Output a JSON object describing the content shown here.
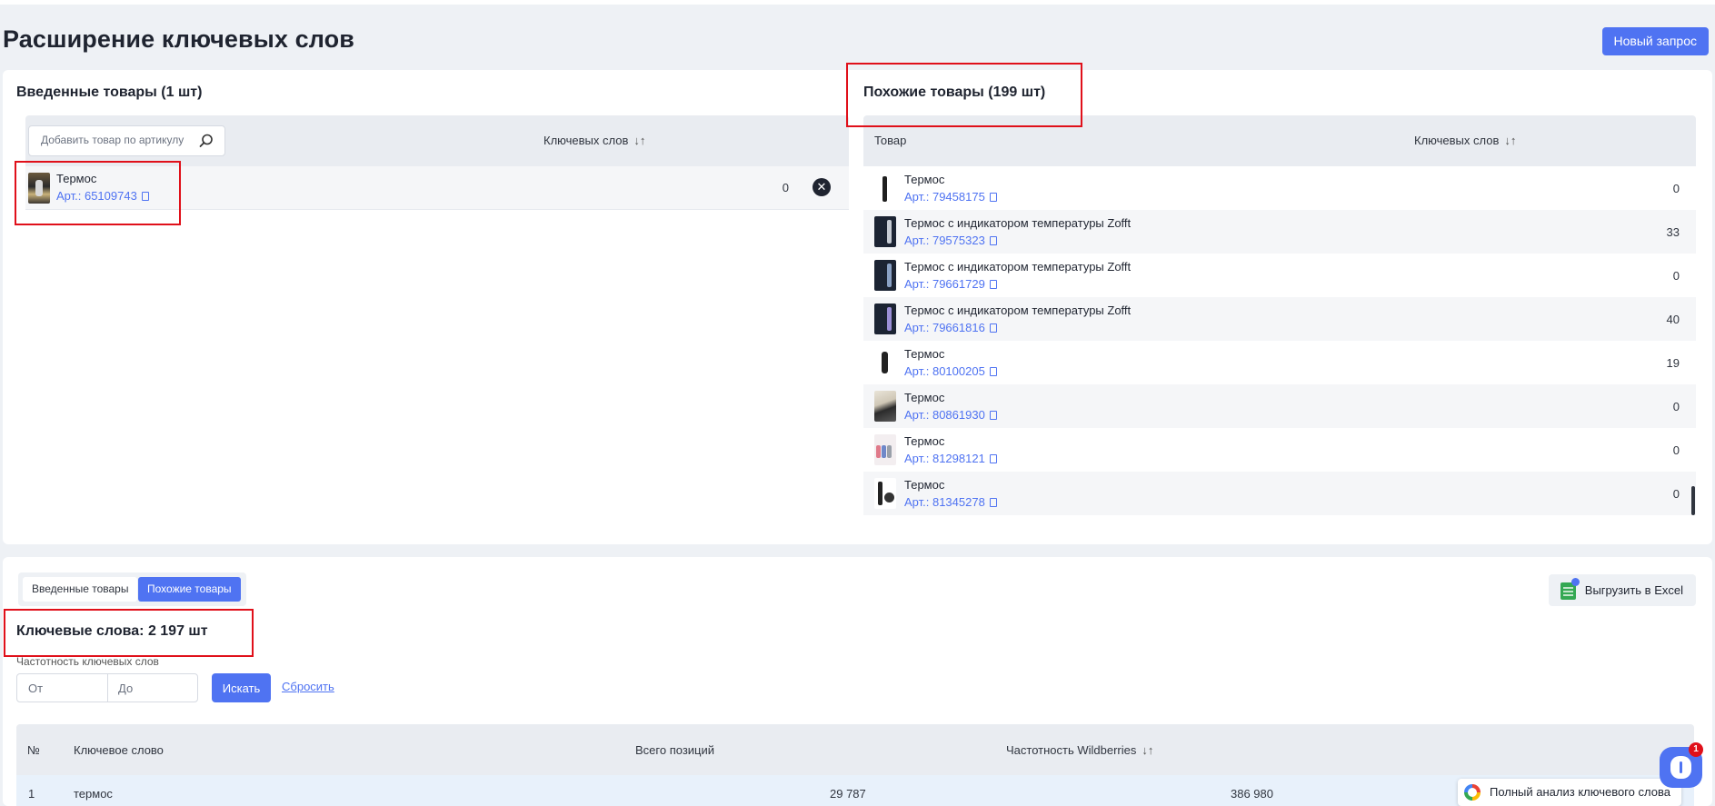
{
  "header": {
    "title": "Расширение ключевых слов",
    "new_request_label": "Новый запрос"
  },
  "entered": {
    "title": "Введенные товары (1 шт)",
    "search_placeholder": "Добавить товар по артикулу",
    "col_keywords": "Ключевых слов",
    "sort_glyph": "↓↑",
    "items": [
      {
        "name": "Термос",
        "article": "Арт.: 65109743",
        "keywords": "0"
      }
    ]
  },
  "similar": {
    "title": "Похожие товары (199 шт)",
    "col_product": "Товар",
    "col_keywords": "Ключевых слов",
    "sort_glyph": "↓↑",
    "items": [
      {
        "name": "Термос",
        "article": "Арт.: 79458175",
        "keywords": "0"
      },
      {
        "name": "Термос с индикатором температуры Zofft",
        "article": "Арт.: 79575323",
        "keywords": "33"
      },
      {
        "name": "Термос с индикатором температуры Zofft",
        "article": "Арт.: 79661729",
        "keywords": "0"
      },
      {
        "name": "Термос с индикатором температуры Zofft",
        "article": "Арт.: 79661816",
        "keywords": "40"
      },
      {
        "name": "Термос",
        "article": "Арт.: 80100205",
        "keywords": "19"
      },
      {
        "name": "Термос",
        "article": "Арт.: 80861930",
        "keywords": "0"
      },
      {
        "name": "Термос",
        "article": "Арт.: 81298121",
        "keywords": "0"
      },
      {
        "name": "Термос",
        "article": "Арт.: 81345278",
        "keywords": "0"
      }
    ]
  },
  "keywords": {
    "tab_entered": "Введенные товары",
    "tab_similar": "Похожие товары",
    "export_label": "Выгрузить в Excel",
    "title": "Ключевые слова: 2 197 шт",
    "freq_label": "Частотность ключевых слов",
    "from_placeholder": "От",
    "to_placeholder": "До",
    "search_label": "Искать",
    "reset_label": "Сбросить",
    "col_num": "№",
    "col_keyword": "Ключевое слово",
    "col_positions": "Всего позиций",
    "col_freq": "Частотность Wildberries",
    "sort_glyph": "↓↑",
    "rows": [
      {
        "num": "1",
        "keyword": "термос",
        "positions": "29 787",
        "freq": "386 980"
      }
    ]
  },
  "widgets": {
    "chat_badge": "1",
    "analysis_label": "Полный анализ ключевого слова"
  },
  "colors": {
    "accent": "#4f73f2",
    "highlight": "#e0101a",
    "header_bg": "#e9ecf1"
  }
}
